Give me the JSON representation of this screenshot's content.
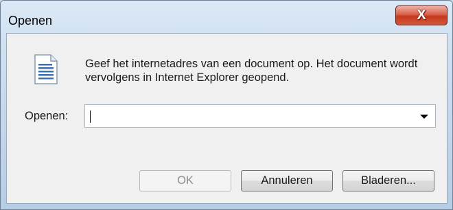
{
  "window": {
    "title": "Openen",
    "close_symbol": "X"
  },
  "icon": {
    "name": "document-icon"
  },
  "description": "Geef het internetadres van een document op. Het document wordt vervolgens in Internet Explorer geopend.",
  "open_field": {
    "label": "Openen:",
    "value": ""
  },
  "buttons": {
    "ok": "OK",
    "cancel": "Annuleren",
    "browse": "Bladeren..."
  }
}
